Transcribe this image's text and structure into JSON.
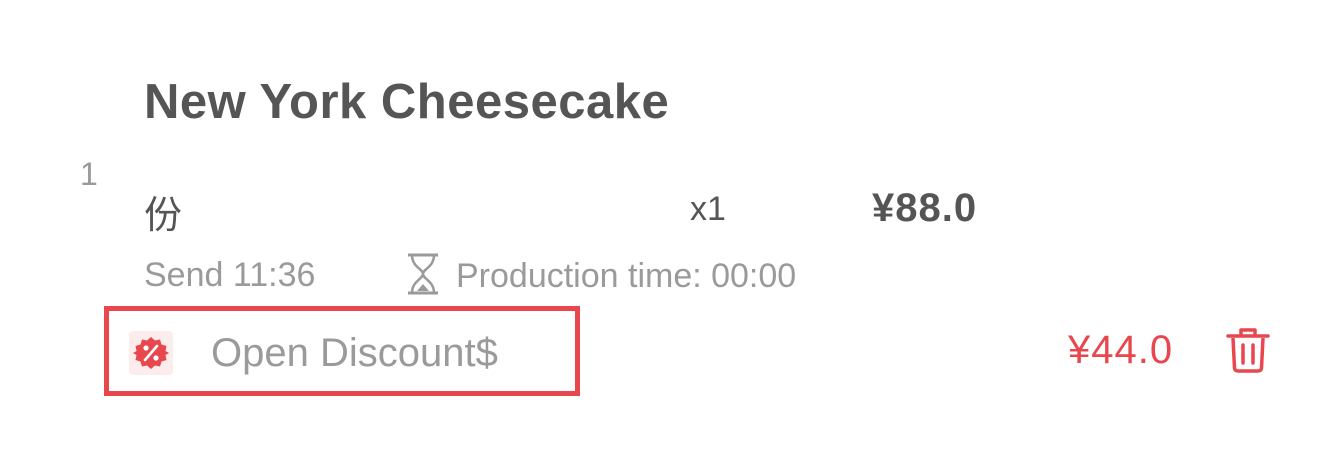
{
  "item": {
    "index": "1",
    "name": "New York Cheesecake",
    "unit": "份",
    "quantity": "x1",
    "price": "¥88.0",
    "send_time": "Send 11:36",
    "production_time": "Production time: 00:00"
  },
  "discount": {
    "label": "Open Discount$",
    "amount": "¥44.0",
    "icon": "discount-badge-icon",
    "delete_icon": "trash-icon"
  },
  "colors": {
    "accent_red": "#e8474d",
    "text_dark": "#555555",
    "text_muted": "#9a9a9a"
  }
}
